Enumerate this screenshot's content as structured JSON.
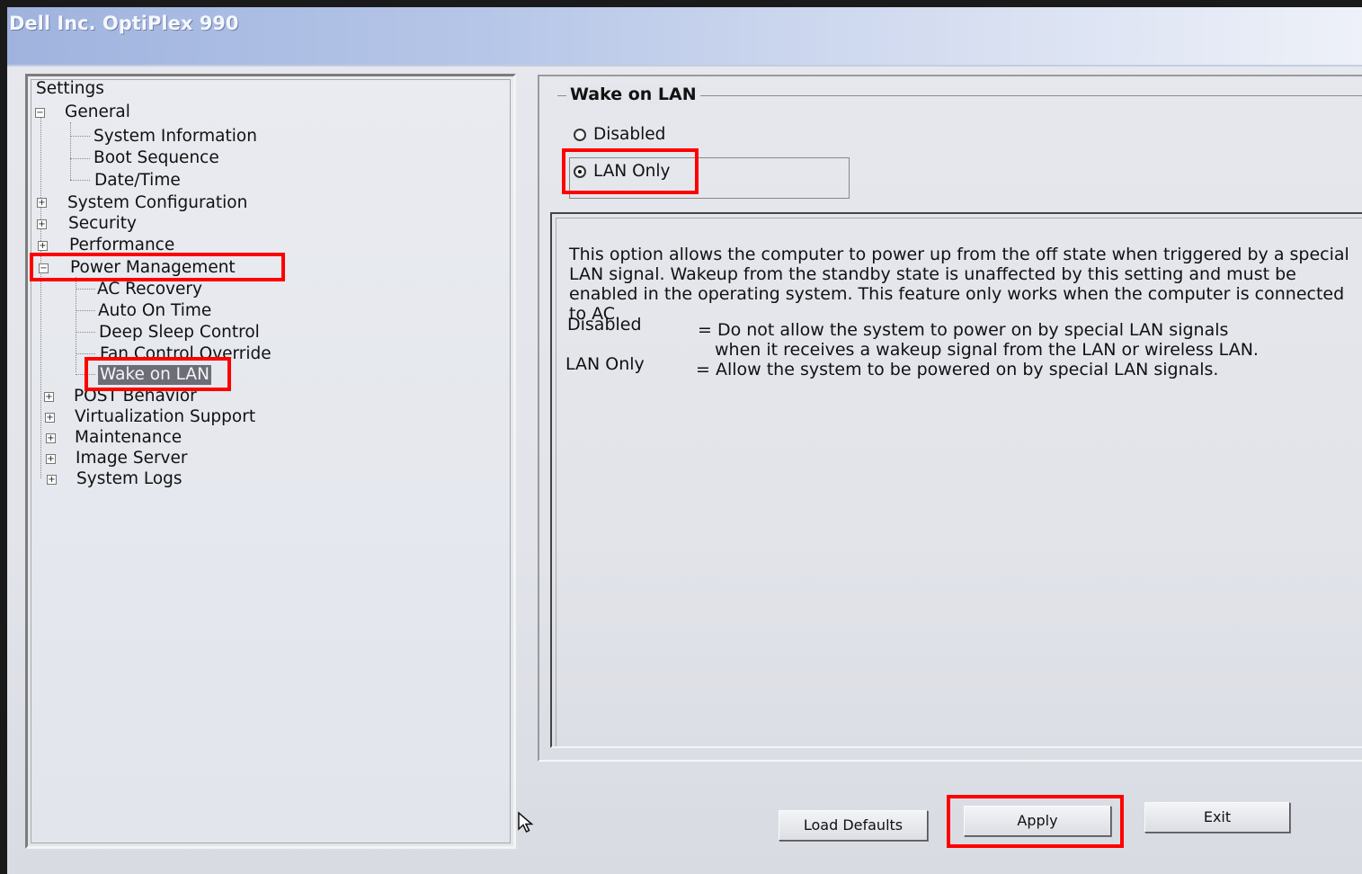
{
  "window": {
    "title": "Dell Inc. OptiPlex 990"
  },
  "tree": {
    "root": "Settings",
    "items": [
      {
        "label": "General",
        "expander": "⊟"
      },
      {
        "label": "System Information"
      },
      {
        "label": "Boot Sequence"
      },
      {
        "label": "Date/Time"
      },
      {
        "label": "System Configuration",
        "expander": "⊞"
      },
      {
        "label": "Security",
        "expander": "⊞"
      },
      {
        "label": "Performance",
        "expander": "⊞"
      },
      {
        "label": "Power Management",
        "expander": "⊟"
      },
      {
        "label": "AC Recovery"
      },
      {
        "label": "Auto On Time"
      },
      {
        "label": "Deep Sleep Control"
      },
      {
        "label": "Fan Control Override"
      },
      {
        "label": "Wake on LAN",
        "selected": true
      },
      {
        "label": "POST Behavior",
        "expander": "⊞"
      },
      {
        "label": "Virtualization Support",
        "expander": "⊞"
      },
      {
        "label": "Maintenance",
        "expander": "⊞"
      },
      {
        "label": "Image Server",
        "expander": "⊞"
      },
      {
        "label": "System Logs",
        "expander": "⊞"
      }
    ]
  },
  "setting": {
    "group_title": "Wake on LAN",
    "options": [
      {
        "label": "Disabled",
        "checked": false
      },
      {
        "label": "LAN Only",
        "checked": true
      }
    ],
    "description": "This option allows the computer to power up from the off state when triggered by a special LAN signal. Wakeup from the standby state is unaffected by this setting and must be enabled in the operating system. This feature only works when the computer is connected to AC.",
    "definitions": [
      {
        "term": "Disabled",
        "text": "= Do not allow the system to power on by special LAN signals",
        "text2": "when it receives a wakeup signal from the LAN or wireless LAN."
      },
      {
        "term": "LAN Only",
        "text": "= Allow the system to be powered on by special LAN signals.",
        "text2": ""
      }
    ]
  },
  "buttons": {
    "load_defaults": "Load Defaults",
    "apply": "Apply",
    "exit": "Exit"
  },
  "annotation_color": "#ff0000"
}
